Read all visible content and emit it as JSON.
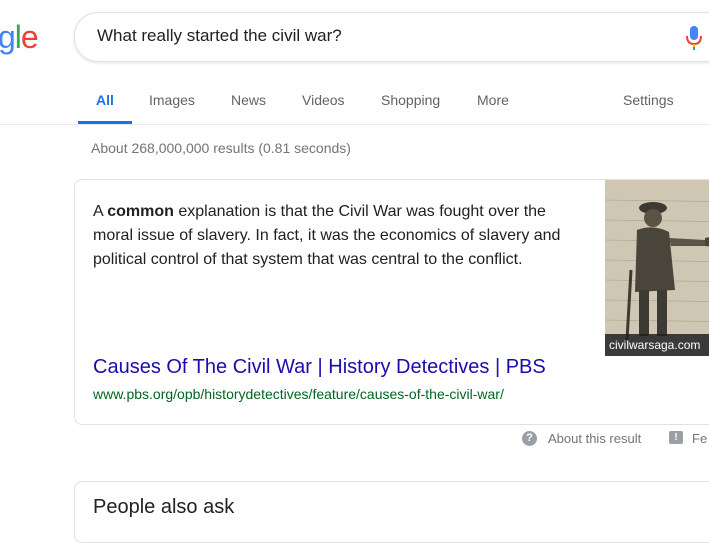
{
  "logo": {
    "text": "gle",
    "colors": [
      "#4285f4",
      "#34a853",
      "#ea4335"
    ]
  },
  "search": {
    "query": "What really started the civil war?"
  },
  "tabs": [
    {
      "label": "All",
      "active": true
    },
    {
      "label": "Images"
    },
    {
      "label": "News"
    },
    {
      "label": "Videos"
    },
    {
      "label": "Shopping"
    },
    {
      "label": "More"
    }
  ],
  "settings_label": "Settings",
  "stats": "About 268,000,000 results (0.81 seconds)",
  "featured": {
    "snippet_pre": "A ",
    "snippet_bold": "common",
    "snippet_post": " explanation is that the Civil War was fought over the moral issue of slavery. In fact, it was the economics of slavery and political control of that system that was central to the conflict.",
    "image_caption": "civilwarsaga.com",
    "title": "Causes Of The Civil War | History Detectives | PBS",
    "url": "www.pbs.org/opb/historydetectives/feature/causes-of-the-civil-war/"
  },
  "about_result": "About this result",
  "feedback": "Fe",
  "people_also_ask": "People also ask",
  "colors": {
    "link": "#1a0dab",
    "url": "#006621",
    "accent": "#1a73e8"
  }
}
